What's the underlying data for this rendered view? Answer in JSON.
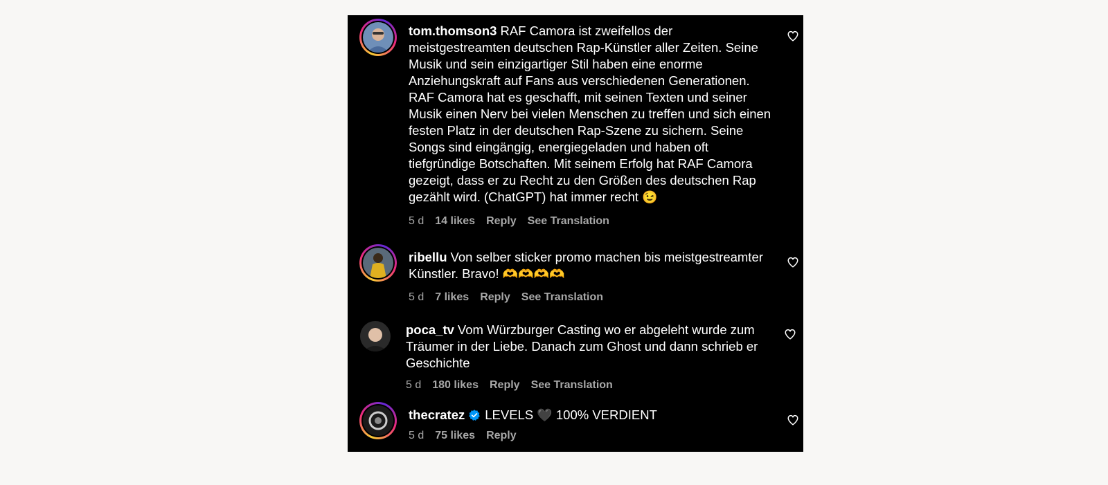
{
  "comments": [
    {
      "username": "tom.thomson3",
      "text": "RAF Camora ist zweifellos der meistgestreamten deutschen Rap-Künstler aller Zeiten. Seine Musik und sein einzigartiger Stil haben eine enorme Anziehungskraft auf Fans aus verschiedenen Generationen. RAF Camora hat es geschafft, mit seinen Texten und seiner Musik einen Nerv bei vielen Menschen zu treffen und sich einen festen Platz in der deutschen Rap-Szene zu sichern. Seine Songs sind eingängig, energiegeladen und haben oft tiefgründige Botschaften. Mit seinem Erfolg hat RAF Camora gezeigt, dass er zu Recht zu den Größen des deutschen Rap gezählt wird. (ChatGPT) hat immer recht",
      "emoji": "😉",
      "time": "5 d",
      "likes": "14 likes",
      "reply": "Reply",
      "translation": "See Translation"
    },
    {
      "username": "ribellu",
      "text": "Von selber sticker promo machen bis meistgestreamter Künstler. Bravo!",
      "emoji": "🫶🫶🫶🫶",
      "time": "5 d",
      "likes": "7 likes",
      "reply": "Reply",
      "translation": "See Translation"
    },
    {
      "username": "poca_tv",
      "text": "Vom Würzburger Casting wo er abgeleht wurde zum Träumer in der Liebe. Danach zum Ghost und dann schrieb er Geschichte",
      "time": "5 d",
      "likes": "180 likes",
      "reply": "Reply",
      "translation": "See Translation"
    },
    {
      "username": "thecratez",
      "verified": true,
      "text_before": "LEVELS",
      "emoji": "🖤",
      "text_after": "100% VERDIENT",
      "time": "5 d",
      "likes": "75 likes",
      "reply": "Reply"
    }
  ],
  "colors": {
    "panel_bg": "#000000",
    "page_bg": "#f8f7f5",
    "text": "#ffffff",
    "meta": "#a8a8a8",
    "verified": "#0095f6"
  },
  "icons": {
    "like": "heart-outline-icon",
    "verified": "verified-badge-icon"
  }
}
